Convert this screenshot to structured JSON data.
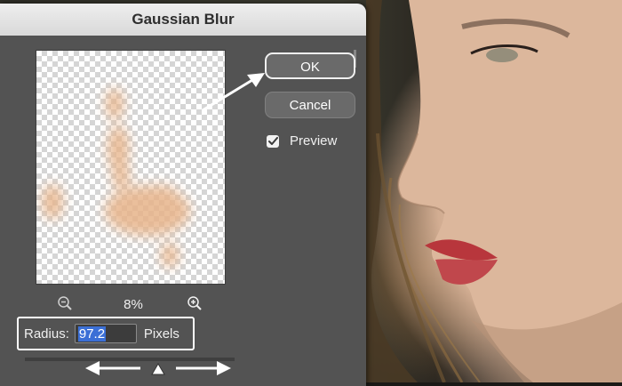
{
  "dialog": {
    "title": "Gaussian Blur",
    "ok_label": "OK",
    "cancel_label": "Cancel",
    "preview_label": "Preview",
    "preview_checked": true,
    "zoom_value": "8%",
    "radius_label": "Radius:",
    "radius_value": "97.2",
    "radius_unit": "Pixels"
  },
  "icons": {
    "zoom_out": "zoom-out-icon",
    "zoom_in": "zoom-in-icon",
    "checkmark": "checkmark-icon",
    "slider_thumb": "slider-thumb-icon"
  },
  "colors": {
    "dialog_bg": "#535353",
    "title_bar": "#e3e3e3",
    "button_bg": "#6a6a6a",
    "selection": "#3b6fd6",
    "annotation": "#ffffff"
  }
}
